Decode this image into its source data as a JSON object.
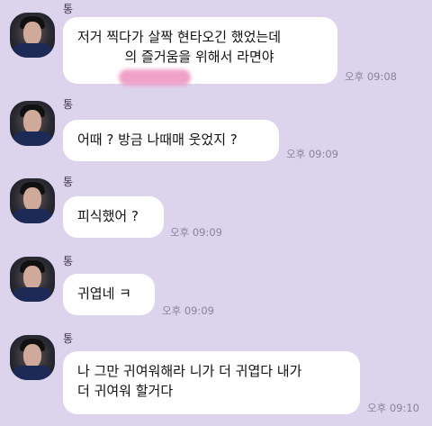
{
  "chat": {
    "messages": [
      {
        "sender": "통",
        "lines": [
          "저거 찍다가 살짝 현타오긴 했었는데",
          "           의 즐거움을 위해서 라면야"
        ],
        "time": "오후 09:08"
      },
      {
        "sender": "통",
        "lines": [
          "어때 ? 방금 나때매 웃었지 ?"
        ],
        "time": "오후 09:09"
      },
      {
        "sender": "통",
        "lines": [
          "피식했어 ?"
        ],
        "time": "오후 09:09"
      },
      {
        "sender": "통",
        "lines": [
          "귀엽네 ㅋ"
        ],
        "time": "오후 09:09"
      },
      {
        "sender": "통",
        "lines": [
          "나 그만 귀여워해라 니가 더 귀엽다 내가",
          "더 귀여워 할거다"
        ],
        "time": "오후 09:10"
      }
    ]
  }
}
